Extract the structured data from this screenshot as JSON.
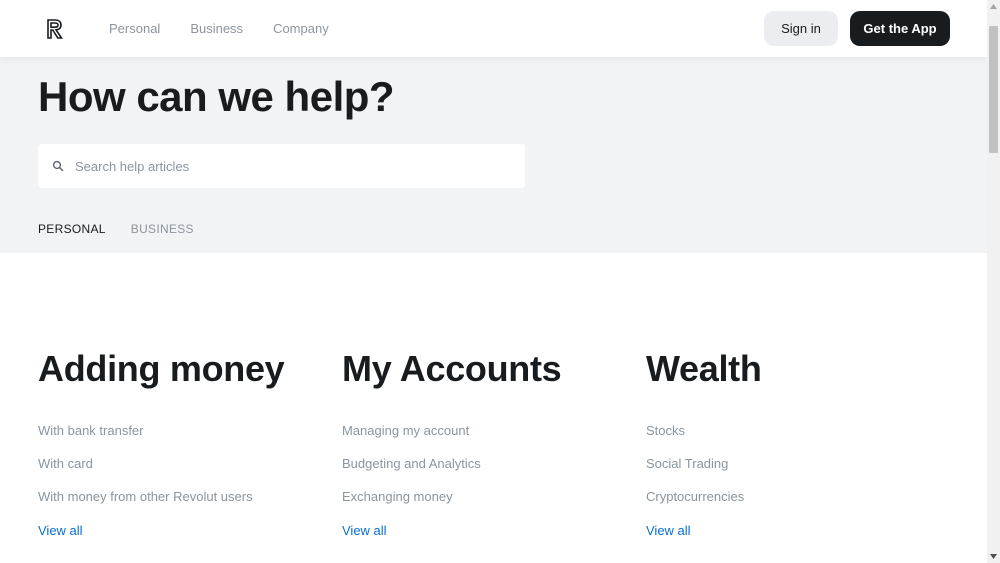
{
  "header": {
    "nav": [
      "Personal",
      "Business",
      "Company"
    ],
    "sign_in_label": "Sign in",
    "get_app_label": "Get the App"
  },
  "hero": {
    "title": "How can we help?",
    "search_placeholder": "Search help articles",
    "tabs": [
      {
        "label": "PERSONAL",
        "active": true
      },
      {
        "label": "BUSINESS",
        "active": false
      }
    ]
  },
  "categories": [
    {
      "title": "Adding money",
      "links": [
        "With bank transfer",
        "With card",
        "With money from other Revolut users"
      ],
      "view_all": "View all"
    },
    {
      "title": "My Accounts",
      "links": [
        "Managing my account",
        "Budgeting and Analytics",
        "Exchanging money"
      ],
      "view_all": "View all"
    },
    {
      "title": "Wealth",
      "links": [
        "Stocks",
        "Social Trading",
        "Cryptocurrencies"
      ],
      "view_all": "View all"
    }
  ],
  "icons": {
    "logo": "revolut-logo-icon",
    "search": "search-icon",
    "scroll_up": "scroll-up-arrow-icon",
    "scroll_down": "scroll-down-arrow-icon"
  },
  "colors": {
    "text_primary": "#191c1f",
    "text_muted": "#8b959e",
    "link_blue": "#0b6fc9",
    "hero_bg": "#f1f3f5",
    "button_dark": "#191c1f",
    "button_light": "#ebedf0"
  }
}
